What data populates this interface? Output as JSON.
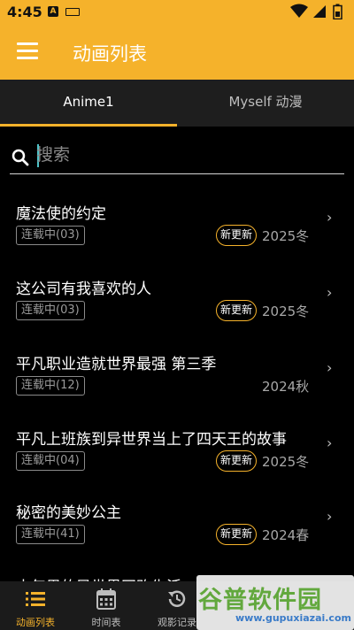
{
  "status_bar": {
    "time": "4:45",
    "a_icon": "A",
    "icons": [
      "notification-a-icon",
      "keyboard-icon",
      "wifi-icon",
      "signal-icon",
      "battery-icon"
    ]
  },
  "app_bar": {
    "title": "动画列表",
    "accent": "#f5b22b"
  },
  "tabs": [
    {
      "label": "Anime1",
      "selected": true
    },
    {
      "label": "Myself 动漫",
      "selected": false
    }
  ],
  "search": {
    "placeholder": "搜索",
    "value": ""
  },
  "items": [
    {
      "title": "魔法使的约定",
      "status": "连载中(03)",
      "badge": "新更新",
      "season": "2025冬"
    },
    {
      "title": "这公司有我喜欢的人",
      "status": "连载中(03)",
      "badge": "新更新",
      "season": "2025冬"
    },
    {
      "title": "平凡职业造就世界最强 第三季",
      "status": "连载中(12)",
      "badge": "",
      "season": "2024秋"
    },
    {
      "title": "平凡上班族到异世界当上了四天王的故事",
      "status": "连载中(04)",
      "badge": "新更新",
      "season": "2025冬"
    },
    {
      "title": "秘密的美妙公主",
      "status": "连载中(41)",
      "badge": "新更新",
      "season": "2024春"
    },
    {
      "title": "中年男的异世界网购生活",
      "status": "",
      "badge": "",
      "season": ""
    }
  ],
  "bottom_nav": [
    {
      "label": "动画列表",
      "icon": "list-icon",
      "active": true
    },
    {
      "label": "时间表",
      "icon": "calendar-icon",
      "active": false
    },
    {
      "label": "观影记录",
      "icon": "history-icon",
      "active": false
    },
    {
      "label": "",
      "icon": "",
      "active": false
    },
    {
      "label": "",
      "icon": "",
      "active": false
    }
  ],
  "watermark": {
    "logo": "谷普软件园",
    "url": "www.gupuxiazai.com"
  }
}
